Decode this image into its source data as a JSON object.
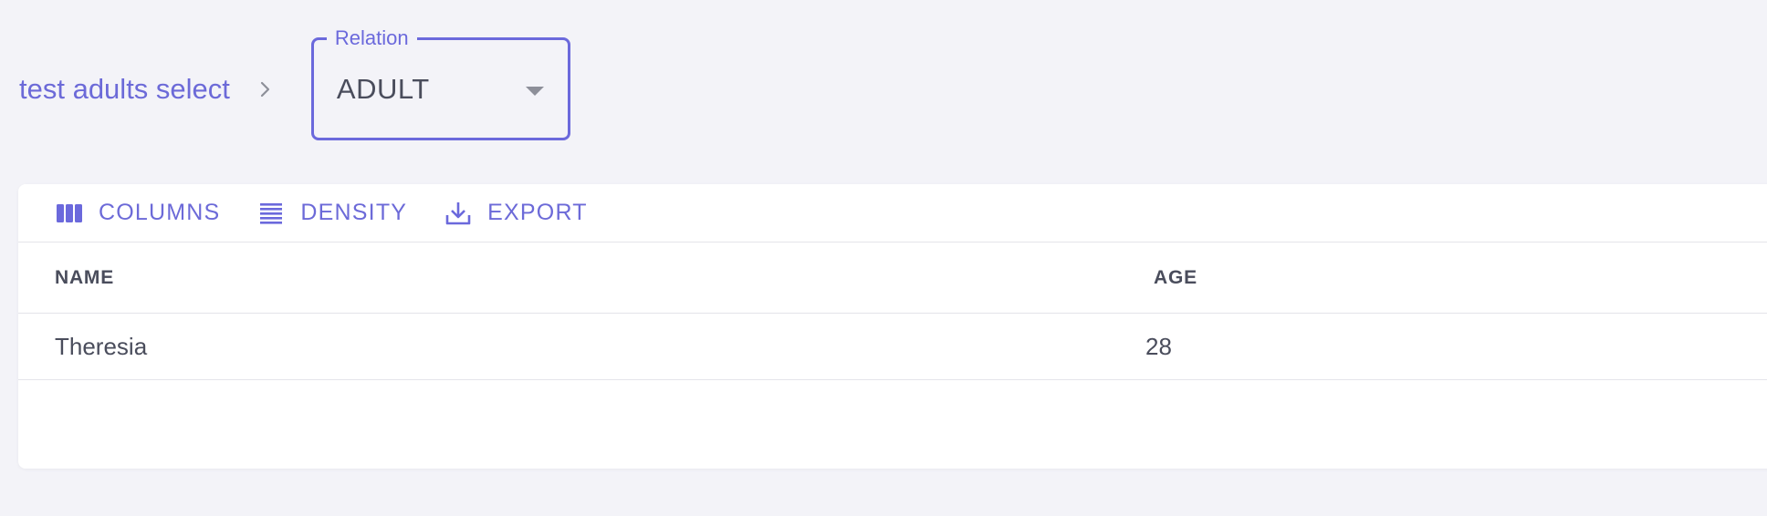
{
  "breadcrumb": {
    "link_label": "test adults select",
    "separator_icon": "chevron-right-icon"
  },
  "relation_select": {
    "legend": "Relation",
    "value": "ADULT",
    "arrow_icon": "caret-down-icon"
  },
  "toolbar": {
    "columns_label": "COLUMNS",
    "columns_icon": "view-column-icon",
    "density_label": "DENSITY",
    "density_icon": "density-lines-icon",
    "export_label": "EXPORT",
    "export_icon": "download-icon"
  },
  "table": {
    "columns": [
      "NAME",
      "AGE"
    ],
    "rows": [
      {
        "name": "Theresia",
        "age": "28"
      }
    ]
  },
  "colors": {
    "accent": "#6b69dc",
    "text": "#4a4d5c",
    "background": "#f3f3f8",
    "card": "#ffffff",
    "divider": "#e4e4ea"
  }
}
